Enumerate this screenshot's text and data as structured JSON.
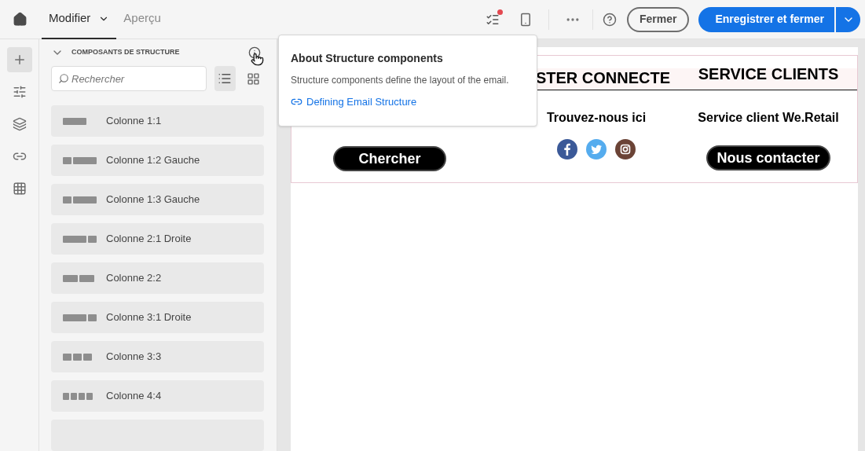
{
  "topbar": {
    "tabs": [
      {
        "label": "Modifier",
        "selected": true,
        "dropdown": true
      },
      {
        "label": "Aperçu",
        "selected": false,
        "dropdown": false
      }
    ],
    "checklist_alert": true,
    "close_button": "Fermer",
    "save_button": "Enregistrer et fermer"
  },
  "rail": [
    {
      "selected": true
    },
    {
      "selected": false
    },
    {
      "selected": false
    },
    {
      "selected": false
    },
    {
      "selected": false
    }
  ],
  "panel": {
    "title": "COMPOSANTS DE STRUCTURE",
    "expanded": true,
    "search": {
      "placeholder": "Rechercher"
    },
    "view": [
      {
        "kind": "list",
        "selected": true
      },
      {
        "kind": "grid",
        "selected": false
      }
    ],
    "more_below": true,
    "components": [
      {
        "label": "Colonne 1:1"
      },
      {
        "label": "Colonne 1:2 Gauche"
      },
      {
        "label": "Colonne 1:3 Gauche"
      },
      {
        "label": "Colonne 2:1 Droite"
      },
      {
        "label": "Colonne 2:2"
      },
      {
        "label": "Colonne 3:1 Droite"
      },
      {
        "label": "Colonne 3:3"
      },
      {
        "label": "Colonne 4:4"
      }
    ]
  },
  "tooltip": {
    "title": "About Structure components",
    "text": "Structure components define the layout of the email.",
    "link": "Defining Email Structure"
  },
  "email": {
    "headings": [
      "STER CONNECTE",
      "SERVICE CLIENTS"
    ],
    "texts": [
      "Trouvez-nous ici",
      "Service client We.Retail"
    ],
    "buttons": [
      "Chercher",
      "Nous contacter"
    ],
    "social": [
      {
        "kind": "facebook"
      },
      {
        "kind": "twitter"
      },
      {
        "kind": "instagram"
      }
    ]
  }
}
